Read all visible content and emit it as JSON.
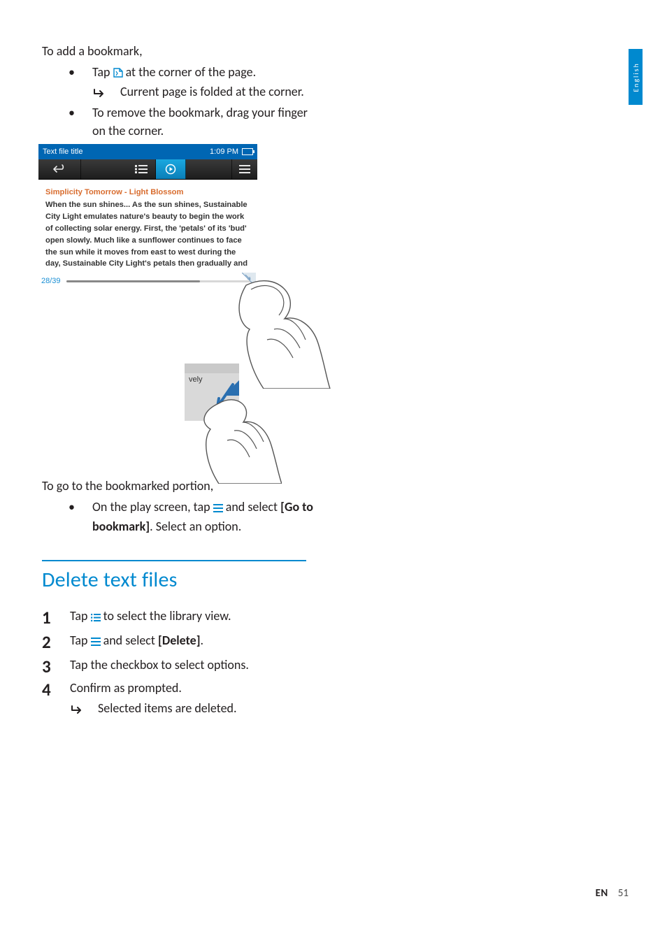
{
  "language_tab": "English",
  "footer": {
    "lang": "EN",
    "page": "51"
  },
  "addBookmark": {
    "heading": "To add a bookmark,",
    "b1_pre": "Tap ",
    "b1_post": " at the corner of the page.",
    "b1_sub": "Current page is folded at the corner.",
    "b2": "To remove the bookmark, drag your finger on the corner."
  },
  "screenshot": {
    "title": "Text file title",
    "time": "1:09 PM",
    "doc_title": "Simplicity Tomorrow - Light Blossom",
    "doc_body": "When the sun shines... As the sun shines, Sustainable City Light emulates nature's beauty to begin the work of collecting solar energy. First, the 'petals' of its 'bud' open slowly. Much like a sunflower continues to face the sun while it moves from east to west during the day, Sustainable City Light's petals then gradually and",
    "page_counter": "28/39",
    "thumb_text": "vely"
  },
  "gotoBookmark": {
    "heading": "To go to the bookmarked portion,",
    "line_pre": "On the play screen, tap ",
    "line_mid": " and select ",
    "bold": "[Go to bookmark]",
    "line_post": ". Select an option."
  },
  "delete": {
    "title": "Delete text files",
    "s1_pre": "Tap ",
    "s1_post": " to select the library view.",
    "s2_pre": "Tap ",
    "s2_mid": " and select ",
    "s2_bold": "[Delete]",
    "s2_post": ".",
    "s3": "Tap the checkbox to select options.",
    "s4": "Confirm as prompted.",
    "s4_sub": "Selected items are deleted."
  }
}
